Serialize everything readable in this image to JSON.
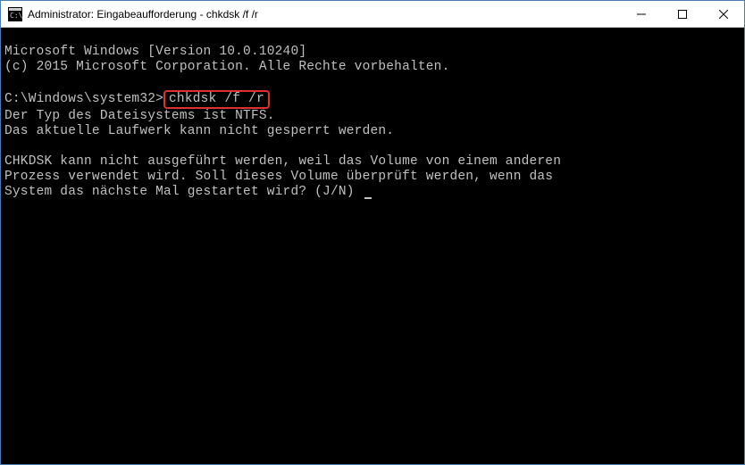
{
  "titlebar": {
    "title": "Administrator: Eingabeaufforderung - chkdsk  /f /r"
  },
  "terminal": {
    "line1": "Microsoft Windows [Version 10.0.10240]",
    "line2": "(c) 2015 Microsoft Corporation. Alle Rechte vorbehalten.",
    "line3": "",
    "prompt": "C:\\Windows\\system32>",
    "command": "chkdsk /f /r",
    "line5": "Der Typ des Dateisystems ist NTFS.",
    "line6": "Das aktuelle Laufwerk kann nicht gesperrt werden.",
    "line7": "",
    "line8": "CHKDSK kann nicht ausgeführt werden, weil das Volume von einem anderen",
    "line9": "Prozess verwendet wird. Soll dieses Volume überprüft werden, wenn das",
    "line10": "System das nächste Mal gestartet wird? (J/N) "
  }
}
